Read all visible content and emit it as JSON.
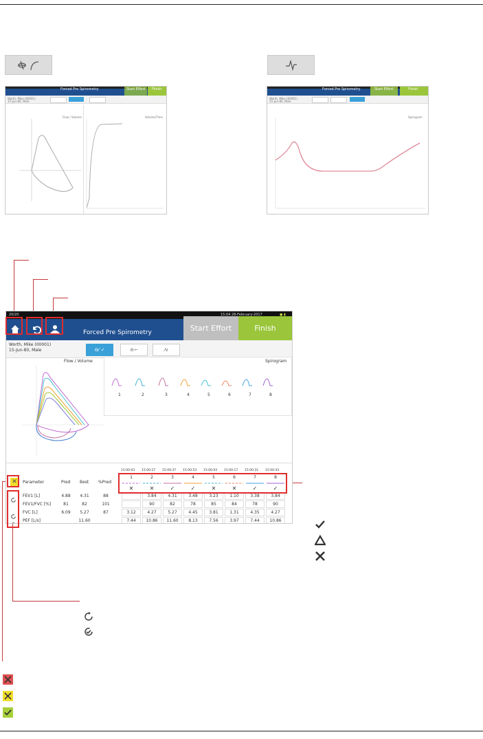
{
  "top_mode_buttons": {
    "flow_volume_icon": "flow-volume-icon",
    "spirogram_icon": "spirogram-icon"
  },
  "thumb_left": {
    "title": "Forced Pre Spirometry",
    "start_label": "Start Effort",
    "finish_label": "Finish",
    "patient_line1": "Worth, Mike (00001)",
    "patient_line2": "15-Jun-80, Male",
    "panel1_title": "Flow / Volume",
    "panel2_title": "Volume/Time"
  },
  "thumb_right": {
    "title": "Forced Pre Spirometry",
    "start_label": "Start Effort",
    "finish_label": "Finish",
    "patient_line1": "Worth, Mike (00001)",
    "patient_line2": "15-Jun-80, Male",
    "panel_title": "Spirogram"
  },
  "screen": {
    "status_left": "20/20",
    "status_right": "15:04 28-February-2017",
    "title": "Forced Pre Spirometry",
    "start_label": "Start Effort",
    "finish_label": "Finish",
    "patient_line1": "Worth, Mike (00001)",
    "patient_line2": "15-Jun-80, Male",
    "tabs": [
      "⊖⁄ ✓",
      "⊖⌐",
      "⁄v"
    ],
    "flow_title": "Flow / Volume",
    "spiro_title": "Spirogram",
    "spiro_trial_labels": [
      "1",
      "2",
      "3",
      "4",
      "5",
      "6",
      "7",
      "8"
    ],
    "table": {
      "headers": {
        "parameter": "Parameter",
        "pred": "Pred",
        "best": "Best",
        "pctpred": "%Pred"
      },
      "trial_times": [
        "15:00:03",
        "15:00:27",
        "15:00:37",
        "15:00:53",
        "15:00:02",
        "15:00:17",
        "15:00:31",
        "15:00:43"
      ],
      "trial_numbers": [
        "1",
        "2",
        "3",
        "4",
        "5",
        "6",
        "7",
        "8"
      ],
      "trial_marks": [
        "✕",
        "✕",
        "✓",
        "✓",
        "✕",
        "✕",
        "✓",
        "✓"
      ],
      "rows": [
        {
          "name": "FEV1 [L]",
          "pred": "4.88",
          "best": "4.31",
          "pct": "88",
          "vals": [
            "",
            "3.84",
            "4.31",
            "3.48",
            "3.23",
            "1.10",
            "3.38",
            "3.84"
          ]
        },
        {
          "name": "FEV1/FVC [%]",
          "pred": "81",
          "best": "82",
          "pct": "101",
          "vals": [
            "",
            "90",
            "82",
            "78",
            "85",
            "84",
            "78",
            "90"
          ]
        },
        {
          "name": "FVC [L]",
          "pred": "6.09",
          "best": "5.27",
          "pct": "87",
          "vals": [
            "3.12",
            "4.27",
            "5.27",
            "4.45",
            "3.81",
            "1.31",
            "4.35",
            "4.27"
          ]
        },
        {
          "name": "PEF [L/s]",
          "pred": "",
          "best": "11.60",
          "pct": "",
          "vals": [
            "7.44",
            "10.86",
            "11.60",
            "8.13",
            "7.56",
            "3.97",
            "7.44",
            "10.86"
          ]
        }
      ]
    }
  },
  "legend_right": {
    "accept_icon": "check-icon",
    "warning_icon": "triangle-icon",
    "reject_icon": "x-icon"
  },
  "legend_refresh": {
    "refresh_icon": "refresh-icon",
    "refresh_check_icon": "refresh-check-icon"
  },
  "legend_bottom": {
    "red": "#e05050",
    "yellow": "#f2dc2b",
    "green": "#a8cf3a"
  },
  "colors": {
    "header_blue": "#1f4f8f",
    "accent_green": "#9bc63b",
    "tab_blue": "#3aa0d8",
    "annotation_red": "#e02c2c"
  }
}
